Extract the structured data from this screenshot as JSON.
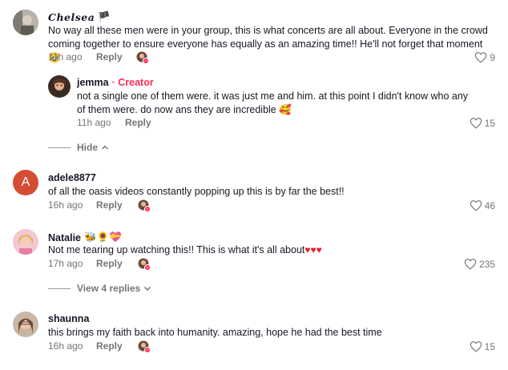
{
  "comments": [
    {
      "user": "Chelsea",
      "user_suffix": "🏴",
      "text": "No way all these men were in your group, this is what concerts are all about. Everyone in the crowd coming together to ensure everyone has equally as an amazing time!! He'll not forget that moment 🥹",
      "time": "11h ago",
      "reply": "Reply",
      "likes": "9"
    },
    {
      "user": "jemma",
      "creator_badge": "· Creator",
      "text": "not a single one of them were. it was just me and him. at this point I didn't know who any of them were. do now ans they are incredible 🥰",
      "time": "11h ago",
      "reply": "Reply",
      "likes": "15"
    },
    {
      "user": "adele8877",
      "avatar_letter": "A",
      "text": "of all the oasis videos constantly popping up this is by far the best!!",
      "time": "16h ago",
      "reply": "Reply",
      "likes": "46"
    },
    {
      "user": "Natalie",
      "user_suffix": "🐝🌻💝",
      "text": "Not me tearing up watching this!! This is what it's all about",
      "text_suffix": "♥♥♥",
      "time": "17h ago",
      "reply": "Reply",
      "likes": "235"
    },
    {
      "user": "shaunna",
      "text": "this brings my faith back into humanity. amazing, hope he had the best time",
      "time": "16h ago",
      "reply": "Reply",
      "likes": "15"
    }
  ],
  "thread_controls": {
    "hide_label": "Hide",
    "view_replies_label": "View 4 replies"
  },
  "icons": {
    "heart": "heart-outline-icon",
    "chevron_up": "chevron-up-icon",
    "chevron_down": "chevron-down-icon"
  },
  "colors": {
    "creator": "#fe2c55",
    "secondary_text": "#757575",
    "avatar_a": "#d64c32"
  }
}
